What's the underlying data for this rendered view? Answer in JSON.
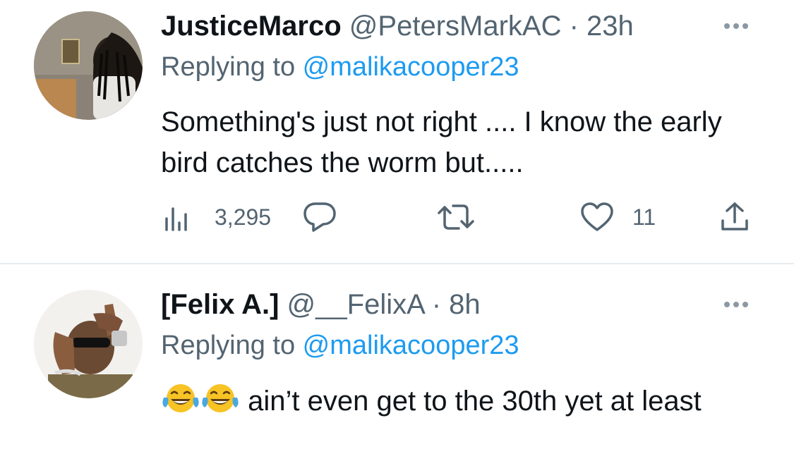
{
  "tweets": [
    {
      "name": "JusticeMarco",
      "handle": "@PetersMarkAC",
      "separator": "·",
      "time": "23h",
      "replying_prefix": "Replying to ",
      "replying_to": "@malikacooper23",
      "text": "Something's just not right .... I know the early bird catches the worm but.....",
      "views": "3,295",
      "likes": "11",
      "icons": [
        "views-icon",
        "reply-icon",
        "retweet-icon",
        "like-icon",
        "share-icon",
        "more-icon"
      ]
    },
    {
      "name": "[Felix A.]",
      "handle": "@__FelixA",
      "separator": "·",
      "time": "8h",
      "replying_prefix": "Replying to ",
      "replying_to": "@malikacooper23",
      "text_emojis": [
        "face-with-tears-of-joy",
        "face-with-tears-of-joy"
      ],
      "text": " ain’t even get to the 30th yet at least",
      "icons": [
        "more-icon"
      ]
    }
  ],
  "colors": {
    "primary_text": "#0f1419",
    "secondary_text": "#536471",
    "link": "#1d9bf0",
    "divider": "#e6ecf0"
  }
}
